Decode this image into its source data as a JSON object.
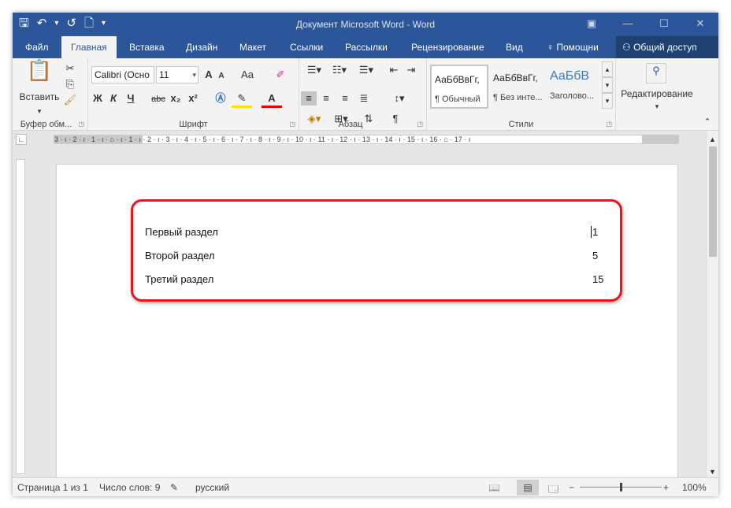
{
  "window": {
    "title": "Документ Microsoft Word - Word"
  },
  "qat": {
    "save": "🖫",
    "undo": "↶",
    "undo_dd": "▾",
    "redo": "↺",
    "new": "🗋",
    "more": "▾"
  },
  "tabs": [
    "Файл",
    "Главная",
    "Вставка",
    "Дизайн",
    "Макет",
    "Ссылки",
    "Рассылки",
    "Рецензирование",
    "Вид"
  ],
  "tell_me": "Помощни",
  "share": "Общий доступ",
  "clipboard": {
    "paste": "Вставить",
    "label": "Буфер обм..."
  },
  "font": {
    "name": "Calibri (Осно",
    "size": "11",
    "label": "Шрифт",
    "bold": "Ж",
    "italic": "К",
    "underline": "Ч",
    "strike": "abc",
    "sub": "x₂",
    "sup": "x²",
    "grow": "A",
    "shrink": "A",
    "case": "Aa"
  },
  "paragraph": {
    "label": "Абзац"
  },
  "styles": {
    "label": "Стили",
    "items": [
      {
        "preview": "АаБбВвГг,",
        "name": "¶ Обычный"
      },
      {
        "preview": "АаБбВвГг,",
        "name": "¶ Без инте..."
      },
      {
        "preview": "АаБбВ",
        "name": "Заголово..."
      }
    ]
  },
  "editing": {
    "label": "Редактирование"
  },
  "ruler": {
    "text": "3 · ı · 2 · ı · 1 · ı · ⌂ · ı · 1 · ı · 2 · ı · 3 · ı · 4 · ı · 5 · ı · 6 · ı · 7 · ı · 8 · ı · 9 · ı · 10 · ı · 11 · ı · 12 · ı · 13 · ı · 14 · ı · 15 · ı · 16 · ⌂ · 17 · ı"
  },
  "toc": [
    {
      "title": "Первый раздел",
      "page": "1"
    },
    {
      "title": "Второй раздел",
      "page": "5"
    },
    {
      "title": "Третий раздел",
      "page": "15"
    }
  ],
  "status": {
    "page": "Страница 1 из 1",
    "words": "Число слов: 9",
    "lang": "русский",
    "zoom": "100%"
  }
}
